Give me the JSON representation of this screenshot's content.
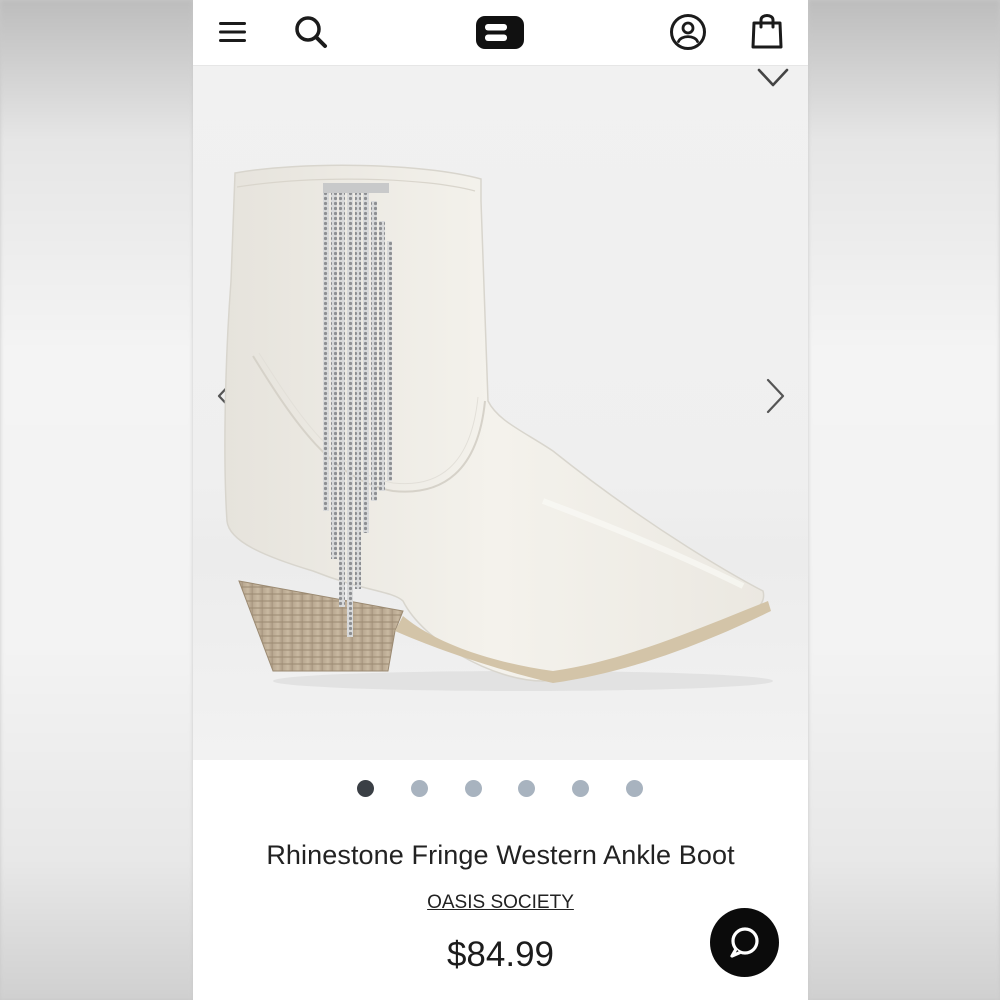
{
  "product": {
    "title": "Rhinestone Fringe Western Ankle Boot",
    "brand": "OASIS SOCIETY",
    "price": "$84.99"
  },
  "gallery": {
    "image_count": 6,
    "active_index": 0,
    "image_alt": "White western ankle boot with rhinestone fringe and stacked wooden heel"
  },
  "header": {
    "icons": [
      "menu-icon",
      "search-icon",
      "logo",
      "account-icon",
      "bag-icon"
    ]
  },
  "icons": {
    "wishlist": "heart-icon",
    "prev": "chevron-left-icon",
    "next": "chevron-right-icon",
    "chat": "chat-icon"
  },
  "colors": {
    "active_dot": "#3a3f45",
    "inactive_dot": "#a8b3bf",
    "chat_button": "#0b0b0b",
    "text": "#222222"
  }
}
